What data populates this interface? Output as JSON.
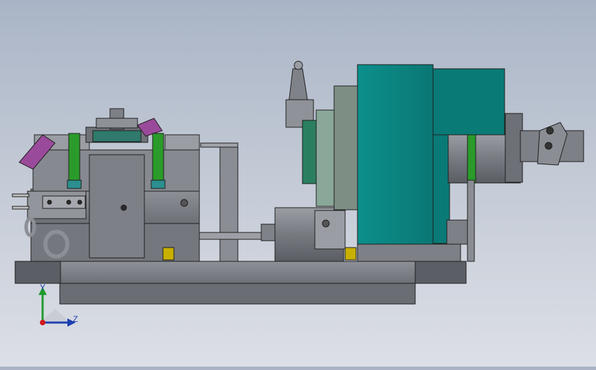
{
  "viewport": {
    "description_label": "",
    "colors": {
      "background_top": "#a9b4c6",
      "background_bottom": "#dcdfe6",
      "body_gray": "#7a7d84",
      "dark_gray": "#55585e",
      "teal": "#0b8582",
      "green": "#2a9b2a",
      "purple": "#9a4a9a",
      "yellow": "#c9b000",
      "edge": "#1e1e1e"
    }
  },
  "triad": {
    "y_label": "Y",
    "z_label": "Z",
    "icons": {
      "y_axis": "axis-arrow-y-icon",
      "z_axis": "axis-arrow-z-icon",
      "origin": "origin-dot-icon"
    }
  }
}
